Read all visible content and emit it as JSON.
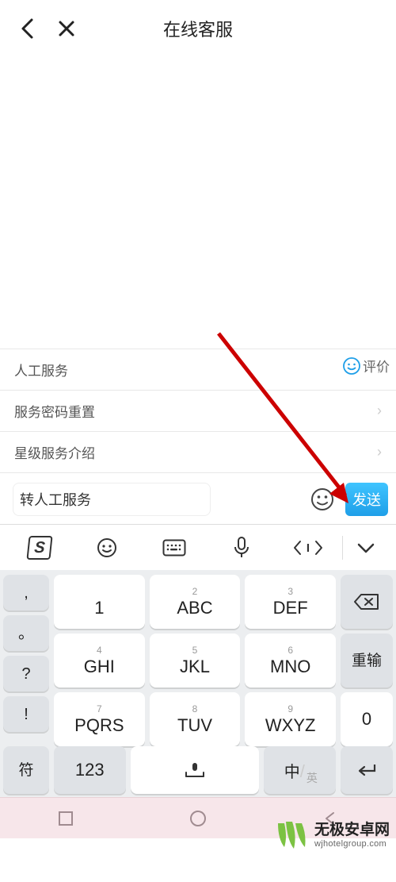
{
  "header": {
    "title": "在线客服"
  },
  "chat": {
    "evaluate_label": "评价"
  },
  "options": {
    "items": [
      {
        "label": "人工服务"
      },
      {
        "label": "服务密码重置"
      },
      {
        "label": "星级服务介绍"
      }
    ]
  },
  "input_bar": {
    "value": "转人工服务",
    "send_label": "发送"
  },
  "ime_toolbar": {
    "icons": [
      "sogou-logo",
      "smile-icon",
      "keyboard-icon",
      "mic-icon",
      "cursor-move-icon",
      "collapse-icon"
    ]
  },
  "keyboard": {
    "row1_left": [
      ",",
      "。",
      "?",
      "!"
    ],
    "grid": [
      [
        {
          "sec": "",
          "pri": "1"
        },
        {
          "sec": "2",
          "pri": "ABC"
        },
        {
          "sec": "3",
          "pri": "DEF"
        }
      ],
      [
        {
          "sec": "4",
          "pri": "GHI"
        },
        {
          "sec": "5",
          "pri": "JKL"
        },
        {
          "sec": "6",
          "pri": "MNO"
        }
      ],
      [
        {
          "sec": "7",
          "pri": "PQRS"
        },
        {
          "sec": "8",
          "pri": "TUV"
        },
        {
          "sec": "9",
          "pri": "WXYZ"
        }
      ]
    ],
    "right": {
      "backspace": "backspace",
      "retype": "重输",
      "zero": "0"
    },
    "bottom": {
      "symbol": "符",
      "numbers": "123",
      "lang_primary": "中",
      "lang_secondary": "英"
    }
  },
  "watermark": {
    "cn": "无极安卓网",
    "url": "wjhotelgroup.com"
  }
}
